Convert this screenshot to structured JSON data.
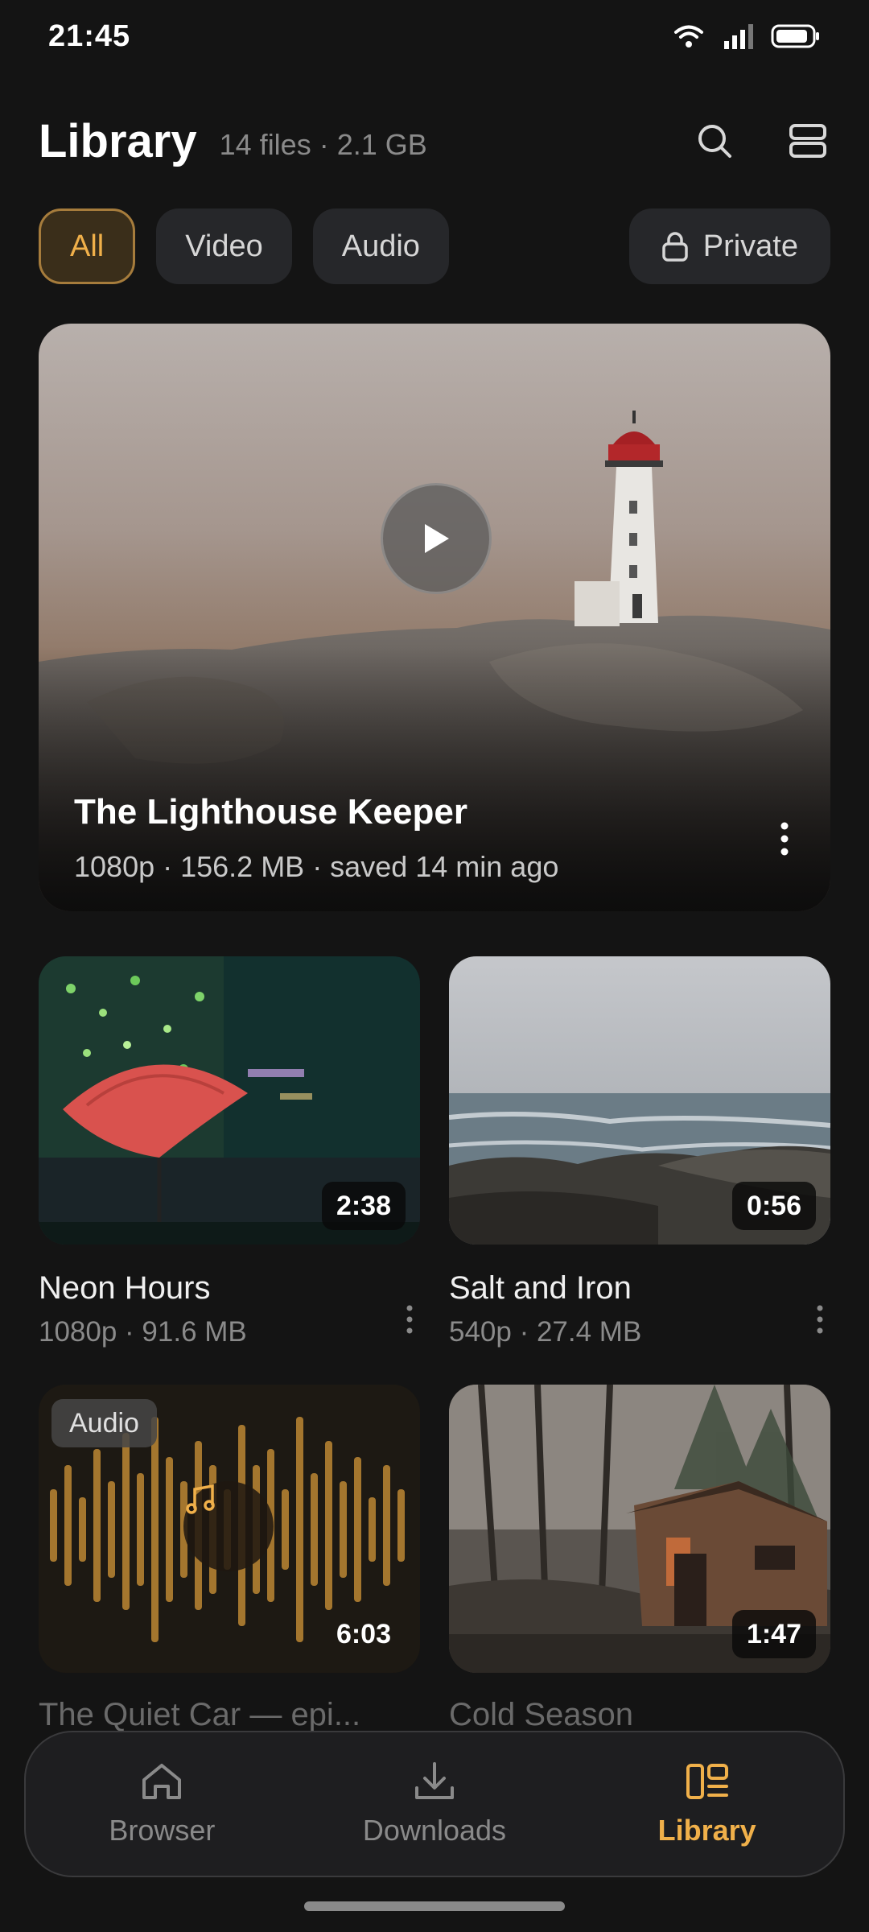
{
  "status_bar": {
    "time": "21:45"
  },
  "header": {
    "title": "Library",
    "subtitle": "14 files · 2.1 GB",
    "icons": [
      "search-icon",
      "list-view-icon"
    ]
  },
  "filters": [
    {
      "label": "All",
      "active": true
    },
    {
      "label": "Video",
      "active": false
    },
    {
      "label": "Audio",
      "active": false
    }
  ],
  "private_chip": {
    "label": "Private",
    "icon": "lock-icon"
  },
  "featured": {
    "title": "The Lighthouse Keeper",
    "meta": "1080p · 156.2 MB · saved 14 min ago"
  },
  "items": [
    {
      "title": "Neon Hours",
      "meta": "1080p · 91.6 MB",
      "duration": "2:38"
    },
    {
      "title": "Salt and Iron",
      "meta": "540p · 27.4 MB",
      "duration": "0:56"
    },
    {
      "title": "The Quiet Car — epi...",
      "badge": "Audio",
      "duration": "6:03"
    },
    {
      "title": "Cold Season",
      "duration": "1:47"
    }
  ],
  "nav": [
    {
      "label": "Browser",
      "icon": "home-icon",
      "active": false
    },
    {
      "label": "Downloads",
      "icon": "download-icon",
      "active": false
    },
    {
      "label": "Library",
      "icon": "library-icon",
      "active": true
    }
  ],
  "colors": {
    "accent": "#f0b04a",
    "background": "#141414"
  }
}
